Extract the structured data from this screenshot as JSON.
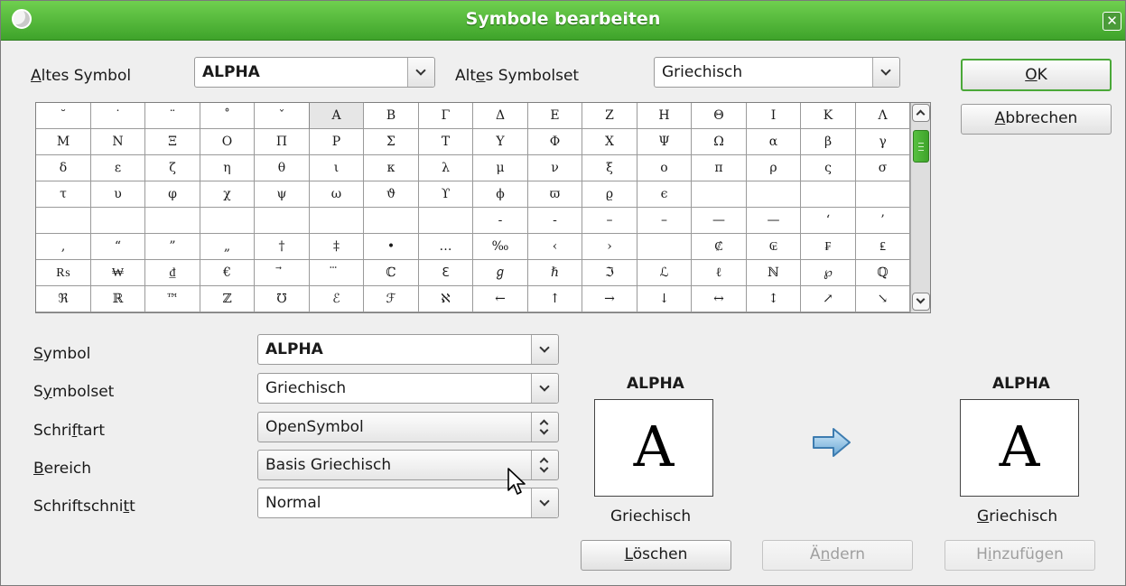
{
  "window": {
    "title": "Symbole bearbeiten"
  },
  "top": {
    "old_symbol_label": "Altes Symbol",
    "old_symbol_value": "ALPHA",
    "old_symbolset_label": "Altes Symbolset",
    "old_symbolset_value": "Griechisch"
  },
  "buttons": {
    "ok": "OK",
    "cancel": "Abbrechen",
    "delete": "Löschen",
    "modify": "Ändern",
    "add": "Hinzufügen"
  },
  "symbol_grid": {
    "selected_index": 5,
    "rows": [
      [
        "˘",
        "˙",
        "¨",
        "˚",
        "ˇ",
        "A",
        "B",
        "Γ",
        "Δ",
        "E",
        "Z",
        "H",
        "Θ",
        "I",
        "K",
        "Λ"
      ],
      [
        "M",
        "N",
        "Ξ",
        "O",
        "Π",
        "P",
        "Σ",
        "T",
        "Y",
        "Φ",
        "X",
        "Ψ",
        "Ω",
        "α",
        "β",
        "γ"
      ],
      [
        "δ",
        "ε",
        "ζ",
        "η",
        "θ",
        "ι",
        "κ",
        "λ",
        "μ",
        "ν",
        "ξ",
        "ο",
        "π",
        "ρ",
        "ς",
        "σ"
      ],
      [
        "τ",
        "υ",
        "φ",
        "χ",
        "ψ",
        "ω",
        "ϑ",
        "ϒ",
        "ϕ",
        "ϖ",
        "ϱ",
        "ϵ",
        "",
        "",
        "",
        ""
      ],
      [
        "",
        "",
        "",
        "",
        "",
        "",
        "",
        "",
        "‐",
        "‐",
        "–",
        "–",
        "—",
        "—",
        "‘",
        "’"
      ],
      [
        "‚",
        "“",
        "”",
        "„",
        "†",
        "‡",
        "•",
        "…",
        "‰",
        "‹",
        "›",
        "",
        "₡",
        "₢",
        "₣",
        "₤"
      ],
      [
        "₨",
        "₩",
        "₫",
        "€",
        "⃗",
        "⃛",
        "ℂ",
        "ℇ",
        "ℊ",
        "ℏ",
        "ℑ",
        "ℒ",
        "ℓ",
        "ℕ",
        "℘",
        "ℚ"
      ],
      [
        "ℜ",
        "ℝ",
        "™",
        "ℤ",
        "℧",
        "ℰ",
        "ℱ",
        "ℵ",
        "←",
        "↑",
        "→",
        "↓",
        "↔",
        "↕",
        "↗",
        "↘"
      ]
    ]
  },
  "form": {
    "symbol_label": "Symbol",
    "symbol_value": "ALPHA",
    "symbolset_label": "Symbolset",
    "symbolset_value": "Griechisch",
    "font_label": "Schriftart",
    "font_value": "OpenSymbol",
    "range_label": "Bereich",
    "range_value": "Basis Griechisch",
    "style_label": "Schriftschnitt",
    "style_value": "Normal"
  },
  "preview_old": {
    "name": "ALPHA",
    "glyph": "A",
    "set": "Griechisch"
  },
  "preview_new": {
    "name": "ALPHA",
    "glyph": "A",
    "set": "Griechisch"
  },
  "icons": {
    "app": "app-icon",
    "close": "close-icon",
    "arrow": "right-arrow-icon",
    "cursor": "mouse-cursor-icon"
  }
}
